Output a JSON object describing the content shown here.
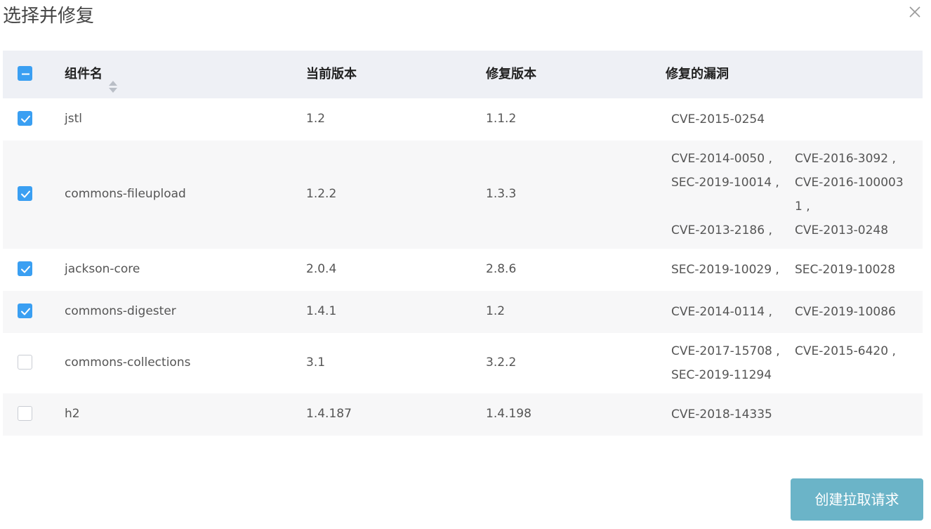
{
  "dialog": {
    "title": "选择并修复"
  },
  "table": {
    "headers": {
      "name": "组件名",
      "current": "当前版本",
      "fix": "修复版本",
      "vulns": "修复的漏洞"
    },
    "rows": [
      {
        "checked": true,
        "name": "jstl",
        "current": "1.2",
        "fix": "1.1.2",
        "vulns": [
          [
            "CVE-2015-0254",
            ""
          ]
        ]
      },
      {
        "checked": true,
        "name": "commons-fileupload",
        "current": "1.2.2",
        "fix": "1.3.3",
        "vulns": [
          [
            "CVE-2014-0050 ,",
            "CVE-2016-3092 ,"
          ],
          [
            "SEC-2019-10014 ,",
            "CVE-2016-100003"
          ],
          [
            "",
            "1 ,"
          ],
          [
            "CVE-2013-2186 ,",
            "CVE-2013-0248"
          ]
        ]
      },
      {
        "checked": true,
        "name": "jackson-core",
        "current": "2.0.4",
        "fix": "2.8.6",
        "vulns": [
          [
            "SEC-2019-10029 ,",
            "SEC-2019-10028"
          ]
        ]
      },
      {
        "checked": true,
        "name": "commons-digester",
        "current": "1.4.1",
        "fix": "1.2",
        "vulns": [
          [
            "CVE-2014-0114 ,",
            "CVE-2019-10086"
          ]
        ]
      },
      {
        "checked": false,
        "name": "commons-collections",
        "current": "3.1",
        "fix": "3.2.2",
        "vulns": [
          [
            "CVE-2017-15708 ,",
            "CVE-2015-6420 ,"
          ],
          [
            "SEC-2019-11294",
            ""
          ]
        ]
      },
      {
        "checked": false,
        "name": "h2",
        "current": "1.4.187",
        "fix": "1.4.198",
        "vulns": [
          [
            "CVE-2018-14335",
            ""
          ]
        ]
      }
    ]
  },
  "actions": {
    "create_pr": "创建拉取请求"
  },
  "colors": {
    "primary": "#3a9ff2",
    "button": "#6bb4c8",
    "header_bg": "#eef0f5",
    "alt_row": "#f7f7f8"
  }
}
